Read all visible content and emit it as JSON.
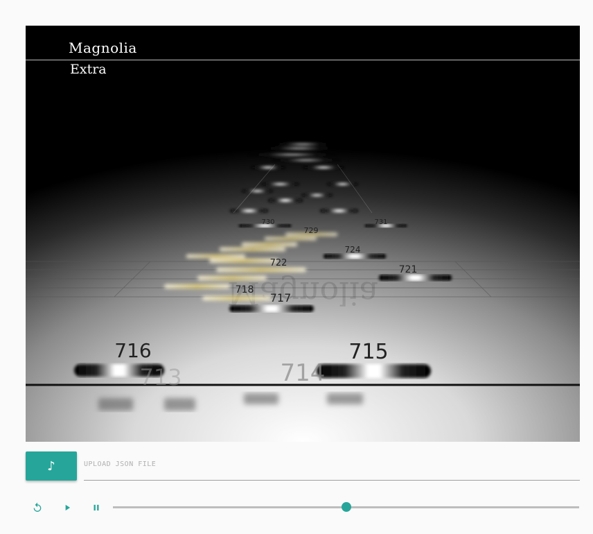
{
  "song": {
    "title": "Magnolia",
    "difficulty": "Extra"
  },
  "upload": {
    "icon": "music-note-icon",
    "placeholder": "UPLOAD JSON FILE"
  },
  "controls": {
    "restart_icon": "restart-icon",
    "play_icon": "play-icon",
    "pause_icon": "pause-icon"
  },
  "progress": {
    "fraction": 0.5
  },
  "colors": {
    "accent": "#26a69a",
    "track": "#bdbdbd",
    "background": "#fafafa"
  },
  "notes": {
    "n715": "715",
    "n716": "716",
    "n714": "714",
    "n713": "713",
    "n717": "717",
    "n718": "718",
    "n721": "721",
    "n722": "722",
    "n724": "724",
    "n729": "729",
    "n730": "730",
    "n731": "731"
  },
  "watermark": "Magnolia"
}
